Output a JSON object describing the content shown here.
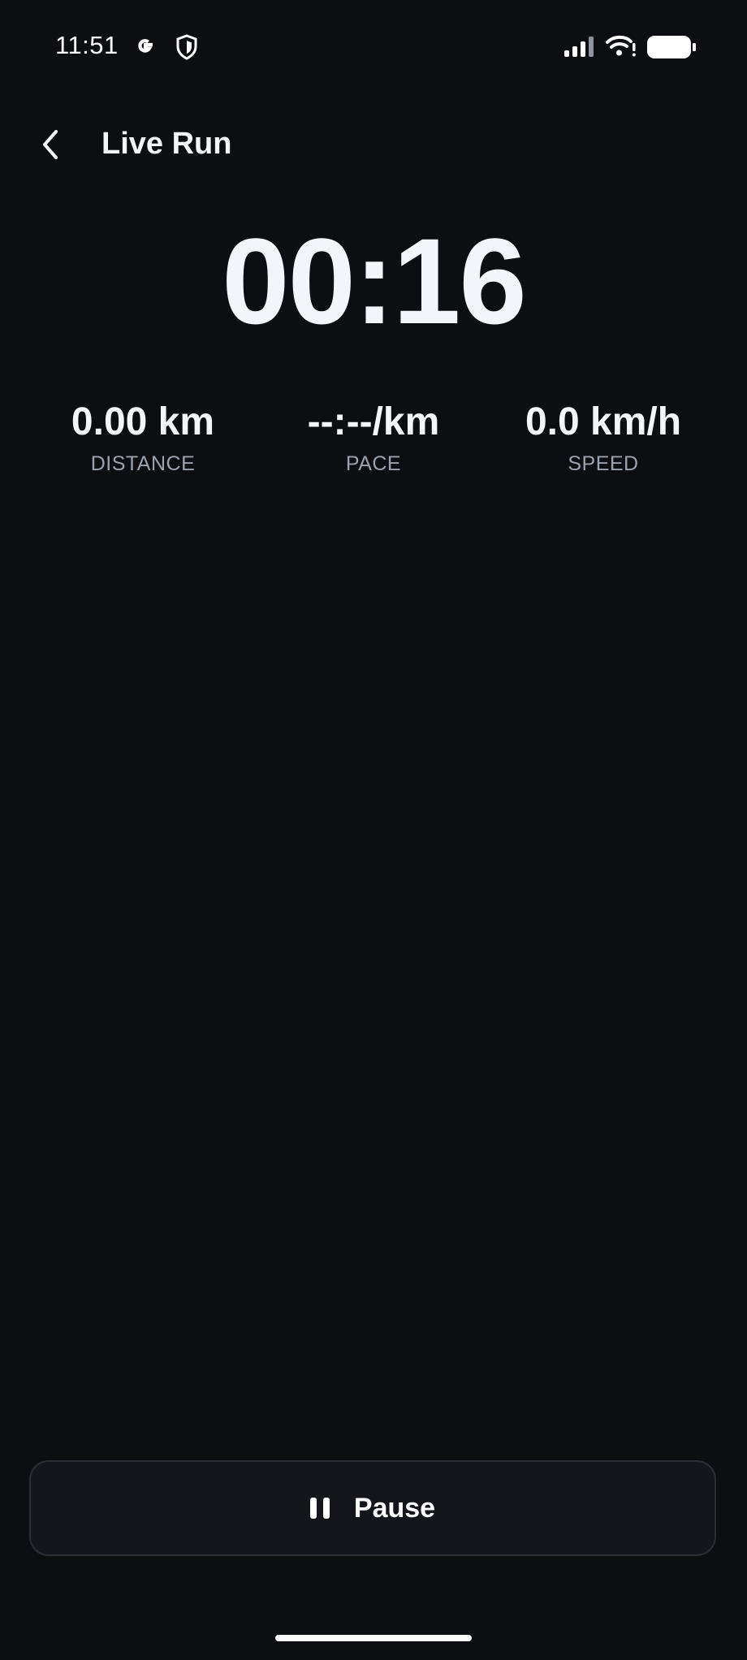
{
  "status_bar": {
    "time": "11:51",
    "icons": [
      "google-icon",
      "shield-icon",
      "signal-icon",
      "wifi-icon",
      "battery-icon"
    ]
  },
  "header": {
    "title": "Live Run",
    "back_icon": "chevron-left-icon"
  },
  "timer": {
    "elapsed": "00:16"
  },
  "stats": {
    "distance": {
      "value": "0.00 km",
      "label": "DISTANCE"
    },
    "pace": {
      "value": "--:--/km",
      "label": "PACE"
    },
    "speed": {
      "value": "0.0 km/h",
      "label": "SPEED"
    }
  },
  "controls": {
    "pause_label": "Pause",
    "pause_icon": "pause-icon"
  },
  "colors": {
    "background": "#0d0e12",
    "text_primary": "#f4f5f8",
    "text_secondary": "#9ba2ae",
    "button_background": "#14161b",
    "button_border": "#2a2d34"
  }
}
